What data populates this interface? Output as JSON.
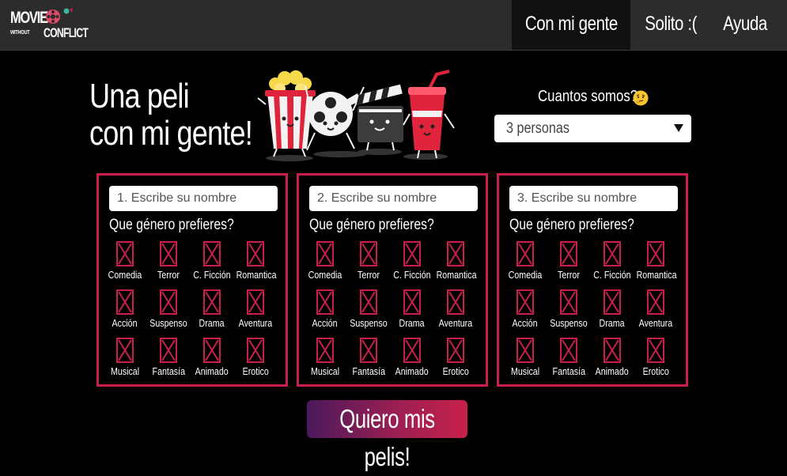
{
  "brand": {
    "word1": "MOVIE",
    "word2": "WITHOUT",
    "word3": "CONFLICT"
  },
  "nav": {
    "items": [
      {
        "label": "Con mi gente",
        "active": true
      },
      {
        "label": "Solito :(",
        "active": false
      },
      {
        "label": "Ayuda",
        "active": false
      }
    ]
  },
  "hero": {
    "line1": "Una peli",
    "line2": "con mi gente!"
  },
  "group": {
    "question": "Cuantos somos?",
    "selected": "3 personas"
  },
  "people": [
    {
      "placeholder": "1. Escribe su nombre"
    },
    {
      "placeholder": "2. Escribe su nombre"
    },
    {
      "placeholder": "3. Escribe su nombre"
    }
  ],
  "genre_question": "Que género prefieres?",
  "genres": [
    "Comedia",
    "Terror",
    "C. Ficción",
    "Romantica",
    "Acción",
    "Suspenso",
    "Drama",
    "Aventura",
    "Musical",
    "Fantasía",
    "Animado",
    "Erotico"
  ],
  "submit_label": "Quiero mis pelis!",
  "colors": {
    "accent": "#c8204a",
    "nav_bg": "#2c2c2c",
    "page_bg": "#000000"
  }
}
